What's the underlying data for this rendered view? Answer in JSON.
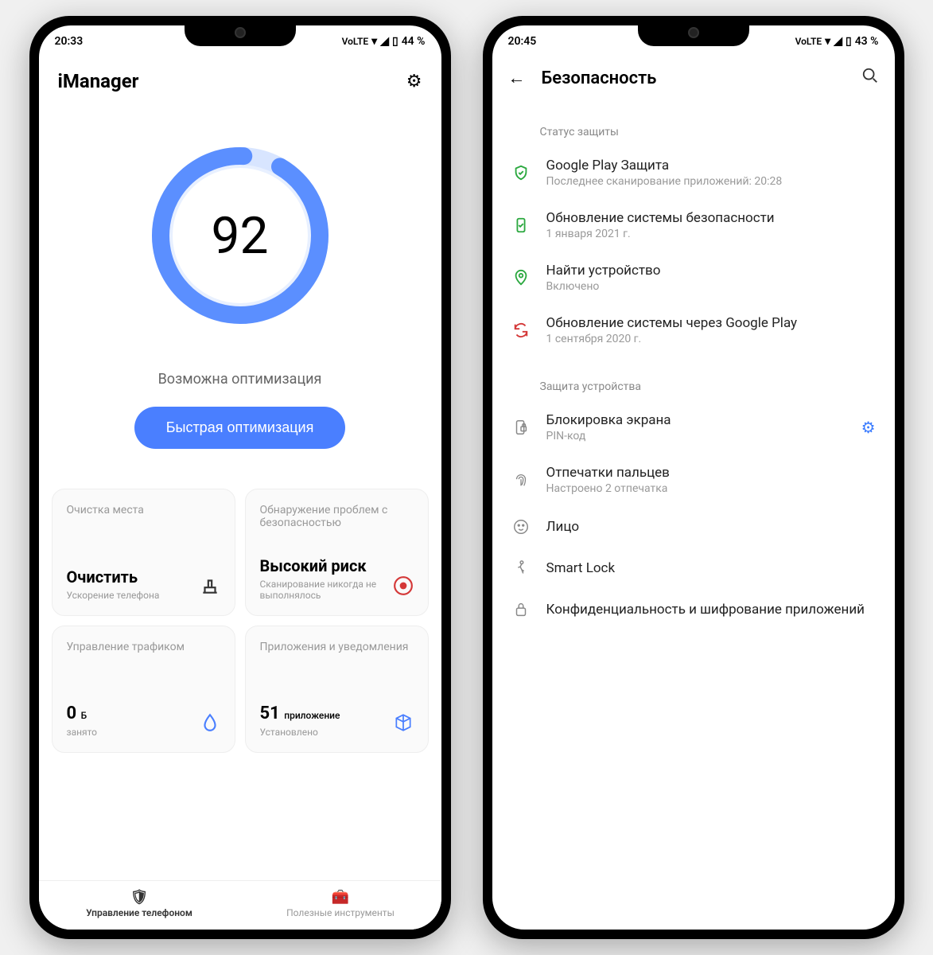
{
  "left": {
    "status": {
      "time": "20:33",
      "battery": "44 %"
    },
    "app_title": "iManager",
    "gauge_score": "92",
    "opt_hint": "Возможна оптимизация",
    "quick_opt": "Быстрая оптимизация",
    "cards": {
      "clean": {
        "header": "Очистка места",
        "title": "Очистить",
        "sub": "Ускорение телефона"
      },
      "security": {
        "header": "Обнаружение проблем с безопасностью",
        "title": "Высокий риск",
        "sub": "Сканирование никогда не выполнялось"
      },
      "traffic": {
        "header": "Управление трафиком",
        "value": "0",
        "unit": "Б",
        "sub": "занято"
      },
      "apps": {
        "header": "Приложения и уведомления",
        "value": "51",
        "unit": "приложение",
        "sub": "Установлено"
      }
    },
    "tabs": {
      "manage": "Управление телефоном",
      "tools": "Полезные инструменты"
    }
  },
  "right": {
    "status": {
      "time": "20:45",
      "battery": "43 %"
    },
    "title": "Безопасность",
    "section1": "Статус защиты",
    "rows1": {
      "playprotect": {
        "title": "Google Play Защита",
        "sub": "Последнее сканирование приложений: 20:28"
      },
      "secupdate": {
        "title": "Обновление системы безопасности",
        "sub": "1 января 2021 г."
      },
      "finddevice": {
        "title": "Найти устройство",
        "sub": "Включено"
      },
      "playupdate": {
        "title": "Обновление системы через Google Play",
        "sub": "1 сентября 2020 г."
      }
    },
    "section2": "Защита устройства",
    "rows2": {
      "screenlock": {
        "title": "Блокировка экрана",
        "sub": "PIN-код"
      },
      "fingerprint": {
        "title": "Отпечатки пальцев",
        "sub": "Настроено 2 отпечатка"
      },
      "face": {
        "title": "Лицо"
      },
      "smartlock": {
        "title": "Smart Lock"
      },
      "encryption": {
        "title": "Конфиденциальность и шифрование приложений"
      }
    }
  }
}
